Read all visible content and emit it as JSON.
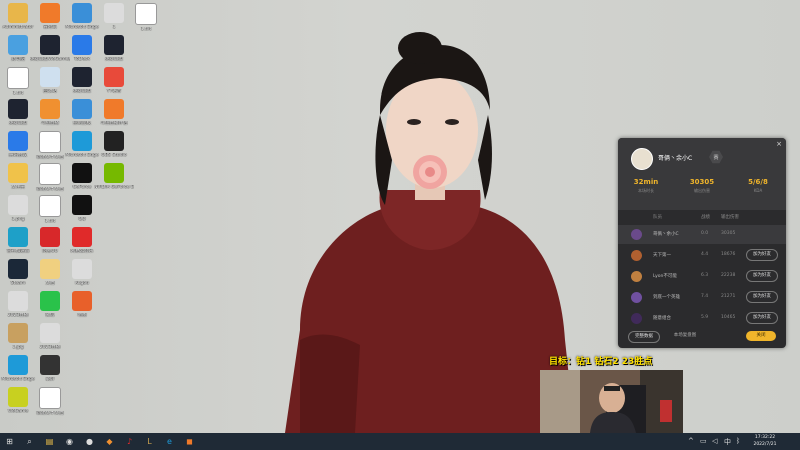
{
  "desktop": {
    "icons": [
      {
        "label": "Administrator",
        "icon": "user-folder-icon",
        "color": "#e8b64a"
      },
      {
        "label": "冒险岛",
        "icon": "game-icon",
        "color": "#f07a2a"
      },
      {
        "label": "Microsoft Edge",
        "icon": "globe-icon",
        "color": "#3a8fd8"
      },
      {
        "label": "1",
        "icon": "window-icon",
        "color": "#dcdcdc"
      },
      {
        "label": "1.txt",
        "icon": "file-icon",
        "color": "#ffffff"
      },
      {
        "label": "此电脑",
        "icon": "computer-icon",
        "color": "#4aa0e0"
      },
      {
        "label": "英雄联盟WeGame版",
        "icon": "lol-icon",
        "color": "#1e2330"
      },
      {
        "label": "ToDesk",
        "icon": "remote-icon",
        "color": "#2a7ae8"
      },
      {
        "label": "英雄联盟",
        "icon": "lol-icon",
        "color": "#1e2330"
      },
      {
        "label": "1.txt",
        "icon": "file-icon",
        "color": "#ffffff"
      },
      {
        "label": "回收站",
        "icon": "recycle-bin-icon",
        "color": "#cfe0ef"
      },
      {
        "label": "英雄联盟",
        "icon": "lol-icon",
        "color": "#1e2330"
      },
      {
        "label": "YY语音",
        "icon": "yy-icon",
        "color": "#e84a3a"
      },
      {
        "label": "英雄联盟",
        "icon": "lol-icon",
        "color": "#1e2330"
      },
      {
        "label": "斗鱼直播",
        "icon": "douyu-icon",
        "color": "#f09030"
      },
      {
        "label": "控制面板",
        "icon": "control-panel-icon",
        "color": "#3a8fd8"
      },
      {
        "label": "斗鱼直播伴侣",
        "icon": "game-icon",
        "color": "#f07a2a"
      },
      {
        "label": "腾讯会议",
        "icon": "meeting-icon",
        "color": "#2a7ae8"
      },
      {
        "label": "新建文本文档",
        "icon": "file-icon",
        "color": "#ffffff"
      },
      {
        "label": "Microsoft Edge",
        "icon": "edge-icon",
        "color": "#1e9ad8"
      },
      {
        "label": "OBS Studio",
        "icon": "obs-icon",
        "color": "#222222"
      },
      {
        "label": "文件夹",
        "icon": "folder-icon",
        "color": "#f0c24a"
      },
      {
        "label": "新建文本文档",
        "icon": "file-icon",
        "color": "#ffffff"
      },
      {
        "label": "GeForce",
        "icon": "geforce-icon",
        "color": "#111111"
      },
      {
        "label": "NVIDIA GeForce Experience",
        "icon": "nvidia-icon",
        "color": "#76b900"
      },
      {
        "label": "1.png",
        "icon": "image-icon",
        "color": "#dcdcdc"
      },
      {
        "label": "1.txt",
        "icon": "file-icon",
        "color": "#ffffff"
      },
      {
        "label": "QQ",
        "icon": "qq-icon",
        "color": "#111111"
      },
      {
        "label": "雷神加速器",
        "icon": "accelerator-icon",
        "color": "#1ea0c8"
      },
      {
        "label": "网易UU",
        "icon": "uu-icon",
        "color": "#d8282a"
      },
      {
        "label": "网易云音乐",
        "icon": "music-icon",
        "color": "#e02a2a"
      },
      {
        "label": "Steam",
        "icon": "steam-icon",
        "color": "#1b2838"
      },
      {
        "label": "文档",
        "icon": "file-icon",
        "color": "#f0d080"
      },
      {
        "label": "Kugou",
        "icon": "window-icon",
        "color": "#dcdcdc"
      },
      {
        "label": "2023直播",
        "icon": "window-icon",
        "color": "#dcdcdc"
      },
      {
        "label": "微信",
        "icon": "wechat-icon",
        "color": "#2ac24a"
      },
      {
        "label": "地图",
        "icon": "map-pin-icon",
        "color": "#e8602a"
      },
      {
        "label": "1.jpg",
        "icon": "image-icon",
        "color": "#c8a060"
      },
      {
        "label": "2023直播",
        "icon": "window-icon",
        "color": "#dcdcdc"
      },
      {
        "label": "Microsoft Edge",
        "icon": "edge-icon",
        "color": "#1e9ad8"
      },
      {
        "label": "录屏",
        "icon": "screen-icon",
        "color": "#333333"
      },
      {
        "label": "WeGame",
        "icon": "wegame-icon",
        "color": "#c8d020"
      },
      {
        "label": "新建文本文档",
        "icon": "file-icon",
        "color": "#ffffff"
      }
    ]
  },
  "panel": {
    "player_name": "哥俩丶余小C",
    "badge": "赛",
    "close_symbol": "×",
    "stats": [
      {
        "value": "32min",
        "label": "本场时长"
      },
      {
        "value": "30305",
        "label": "输出伤害"
      },
      {
        "value": "5/6/8",
        "label": "KDA"
      }
    ],
    "columns": [
      "队员",
      "战绩",
      "输出伤害"
    ],
    "rows": [
      {
        "name": "哥俩丶余小C",
        "kda": "0.0",
        "damage": "30305",
        "button": "",
        "self": true,
        "avatar_color": "#6a4a8a"
      },
      {
        "name": "天下第一",
        "kda": "4.4",
        "damage": "18676",
        "button": "加为好友",
        "self": false,
        "avatar_color": "#b06030"
      },
      {
        "name": "Lyon不可能",
        "kda": "6.3",
        "damage": "22238",
        "button": "加为好友",
        "self": false,
        "avatar_color": "#c08040"
      },
      {
        "name": "到底一个英雄",
        "kda": "7.4",
        "damage": "21271",
        "button": "加为好友",
        "self": false,
        "avatar_color": "#7050a0"
      },
      {
        "name": "随意组合",
        "kda": "5.9",
        "damage": "10465",
        "button": "加为好友",
        "self": false,
        "avatar_color": "#402a5a"
      }
    ],
    "footer": {
      "left": "完整数据",
      "middle": "本场复盘图",
      "right": "关闭"
    }
  },
  "overlay_text": "目标：钻1  钻石2 23胜点",
  "taskbar": {
    "icons": [
      "windows-start-icon",
      "search-icon",
      "file-explorer-icon",
      "steam-icon",
      "obs-icon",
      "douyu-icon",
      "netease-music-icon",
      "lol-icon",
      "edge-icon",
      "game-icon"
    ],
    "tray": [
      "chevron-up-icon",
      "network-icon",
      "volume-icon",
      "input-method-icon",
      "bluetooth-icon"
    ],
    "time": "17:32:22",
    "date": "2022/7/21"
  }
}
